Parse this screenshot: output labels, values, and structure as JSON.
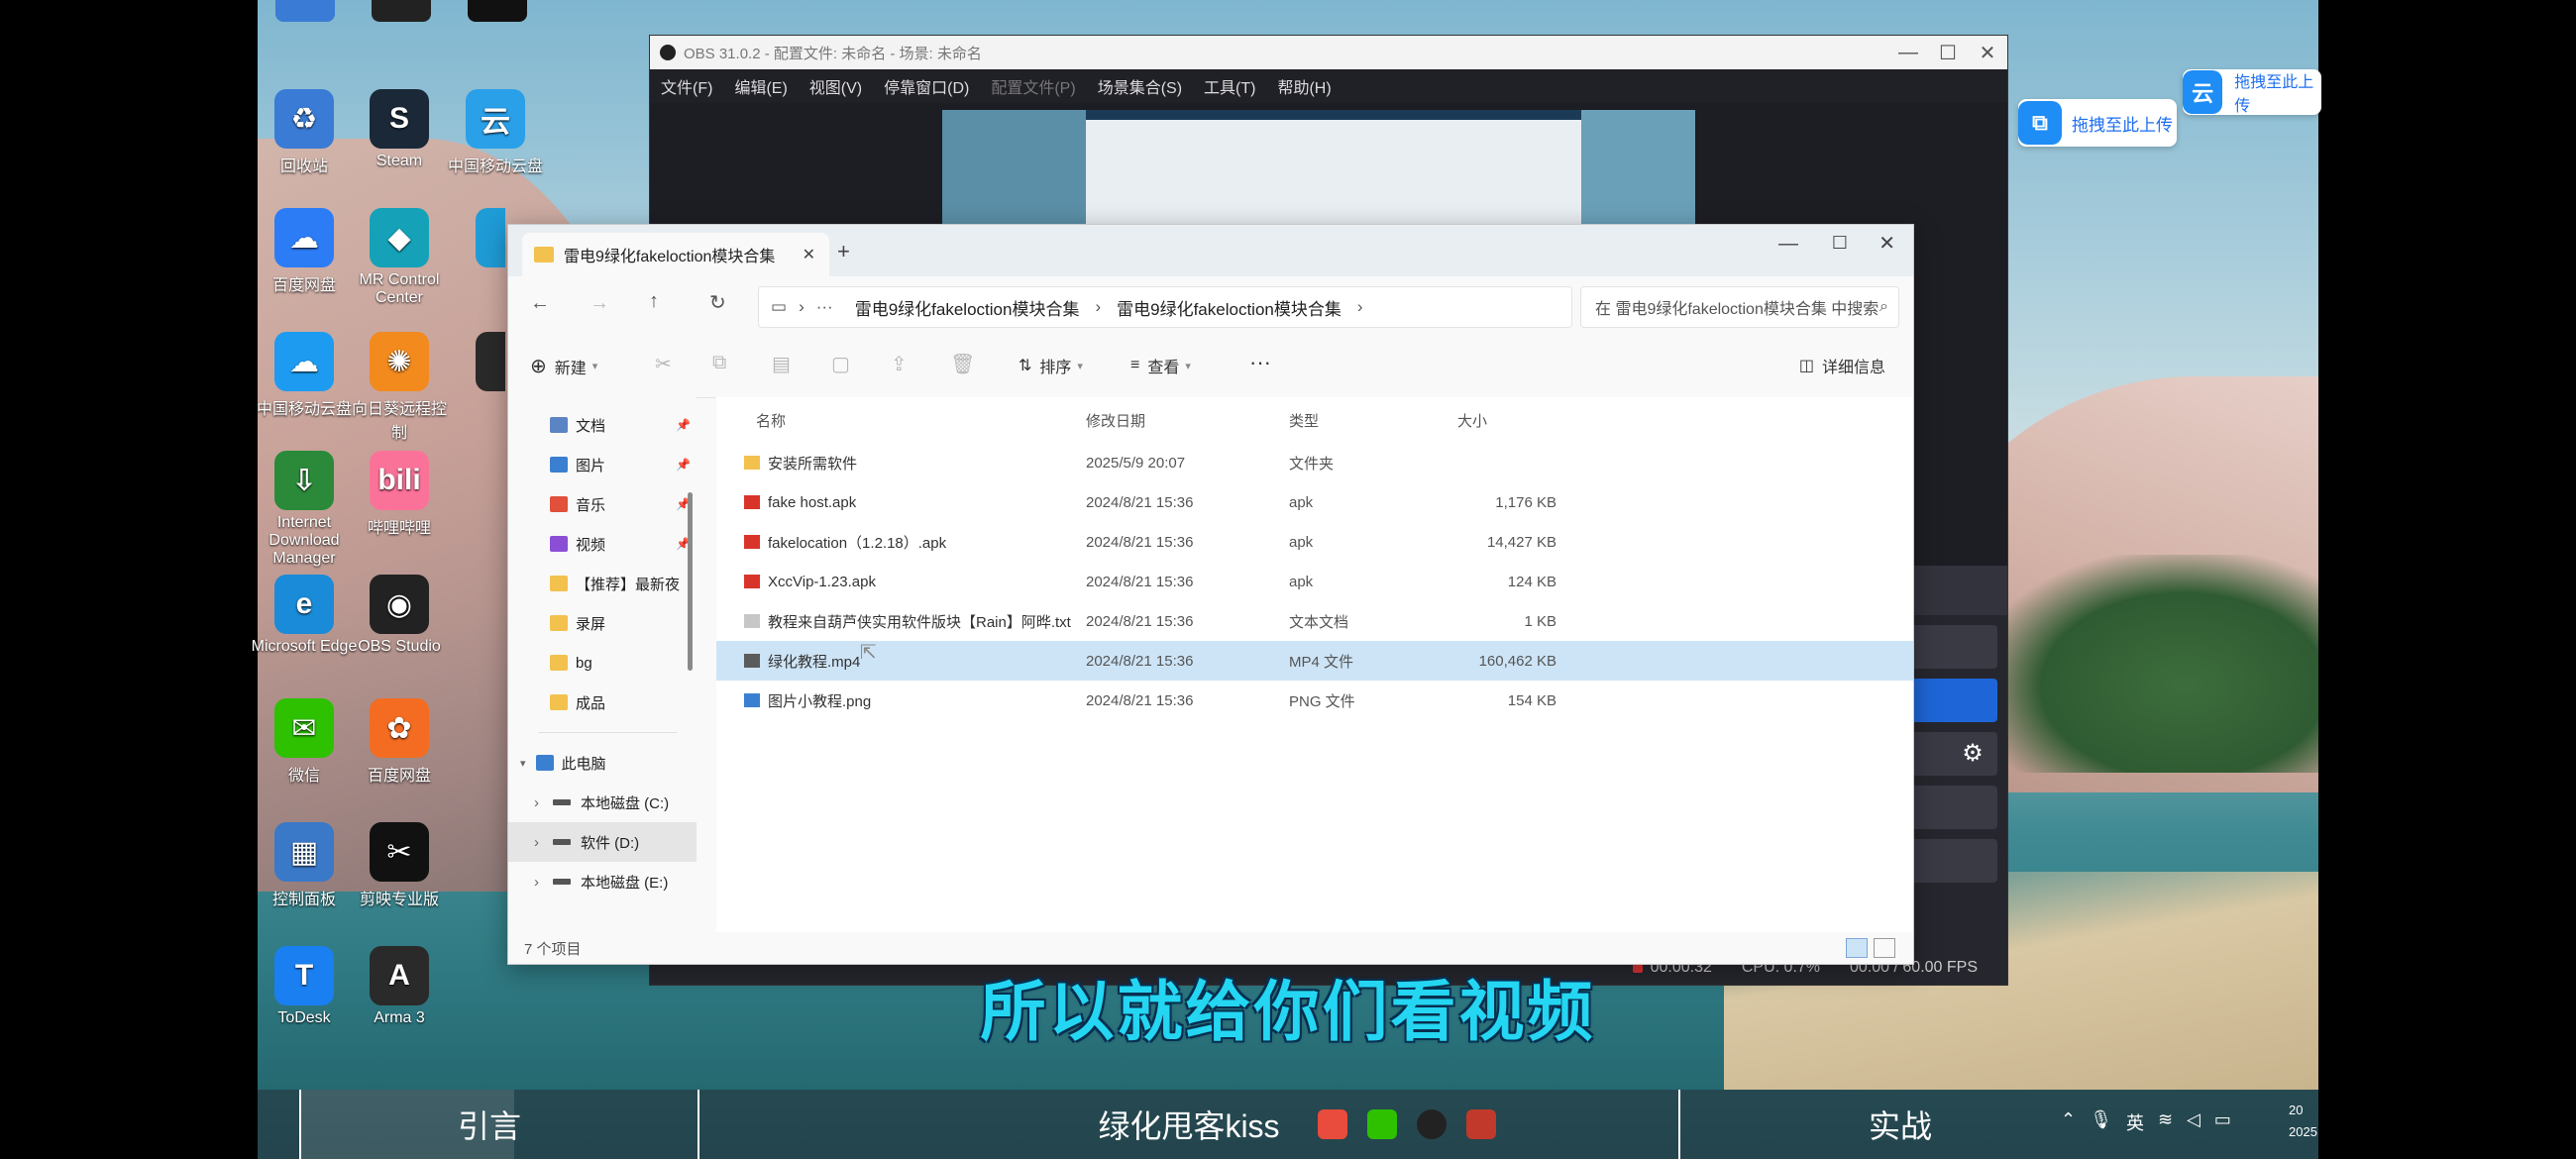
{
  "desktop": {
    "icons": [
      {
        "label": "回收站",
        "color": "#3a7bd5",
        "glyph": "♻"
      },
      {
        "label": "Steam",
        "color": "#1b2838",
        "glyph": "S"
      },
      {
        "label": "中国移动云盘",
        "color": "#2aa0e8",
        "glyph": "云"
      },
      {
        "label": "百度网盘",
        "color": "#2c7cf6",
        "glyph": "☁"
      },
      {
        "label": "MR Control Center",
        "color": "#15a2b8",
        "glyph": "◆"
      },
      {
        "label": "中国移动云盘",
        "color": "#1d9bf0",
        "glyph": "☁"
      },
      {
        "label": "向日葵远程控制",
        "color": "#f28a1d",
        "glyph": "✺"
      },
      {
        "label": "Internet Download Manager",
        "color": "#2a8a3a",
        "glyph": "⇩"
      },
      {
        "label": "哔哩哔哩",
        "color": "#fb7299",
        "glyph": "bili"
      },
      {
        "label": "Microsoft Edge",
        "color": "#1a8bd8",
        "glyph": "e"
      },
      {
        "label": "OBS Studio",
        "color": "#222222",
        "glyph": "◉"
      },
      {
        "label": "微信",
        "color": "#2dc100",
        "glyph": "✉"
      },
      {
        "label": "百度网盘",
        "color": "#f36c21",
        "glyph": "✿"
      },
      {
        "label": "控制面板",
        "color": "#3a78c8",
        "glyph": "▦"
      },
      {
        "label": "剪映专业版",
        "color": "#111111",
        "glyph": "✂"
      },
      {
        "label": "ToDesk",
        "color": "#1a7ff0",
        "glyph": "T"
      },
      {
        "label": "Arma 3",
        "color": "#2a2a2a",
        "glyph": "A"
      }
    ]
  },
  "obs": {
    "title": "OBS 31.0.2 - 配置文件: 未命名 - 场景: 未命名",
    "menu": [
      "文件(F)",
      "编辑(E)",
      "视图(V)",
      "停靠窗口(D)",
      "配置文件(P)",
      "场景集合(S)",
      "工具(T)",
      "帮助(H)"
    ],
    "status_fps": "00.00 / 60.00 FPS",
    "status_cpu": "CPU: 0.7%",
    "status_time": "00:00:32"
  },
  "upload_widgets": {
    "top": "拖拽至此上传",
    "bottom": "拖拽至此上传"
  },
  "explorer": {
    "tab_title": "雷电9绿化fakeloction模块合集",
    "breadcrumb": [
      "雷电9绿化fakeloction模块合集",
      "雷电9绿化fakeloction模块合集"
    ],
    "search_placeholder": "在 雷电9绿化fakeloction模块合集 中搜索",
    "toolbar": {
      "new": "新建",
      "sort": "排序",
      "view": "查看",
      "more": "···",
      "details": "详细信息"
    },
    "nav": [
      {
        "label": "文档",
        "pinned": true,
        "color": "#5b84c4"
      },
      {
        "label": "图片",
        "pinned": true,
        "color": "#3b7fd1"
      },
      {
        "label": "音乐",
        "pinned": true,
        "color": "#e0503a"
      },
      {
        "label": "视频",
        "pinned": true,
        "color": "#8b4fd6"
      },
      {
        "label": "【推荐】最新夜",
        "pinned": false,
        "color": "#f2c14e"
      },
      {
        "label": "录屏",
        "pinned": false,
        "color": "#f2c14e"
      },
      {
        "label": "bg",
        "pinned": false,
        "color": "#f2c14e"
      },
      {
        "label": "成品",
        "pinned": false,
        "color": "#f2c14e"
      }
    ],
    "this_pc": "此电脑",
    "drives": [
      "本地磁盘 (C:)",
      "软件 (D:)",
      "本地磁盘 (E:)"
    ],
    "columns": {
      "name": "名称",
      "date": "修改日期",
      "type": "类型",
      "size": "大小"
    },
    "files": [
      {
        "name": "安装所需软件",
        "date": "2025/5/9 20:07",
        "type": "文件夹",
        "size": "",
        "icon": "folder"
      },
      {
        "name": "fake host.apk",
        "date": "2024/8/21 15:36",
        "type": "apk",
        "size": "1,176 KB",
        "icon": "apk"
      },
      {
        "name": "fakelocation（1.2.18）.apk",
        "date": "2024/8/21 15:36",
        "type": "apk",
        "size": "14,427 KB",
        "icon": "apk"
      },
      {
        "name": "XccVip-1.23.apk",
        "date": "2024/8/21 15:36",
        "type": "apk",
        "size": "124 KB",
        "icon": "apk"
      },
      {
        "name": "教程来自葫芦侠实用软件版块【Rain】阿晔.txt",
        "date": "2024/8/21 15:36",
        "type": "文本文档",
        "size": "1 KB",
        "icon": "txt"
      },
      {
        "name": "绿化教程.mp4",
        "date": "2024/8/21 15:36",
        "type": "MP4 文件",
        "size": "160,462 KB",
        "icon": "mp4"
      },
      {
        "name": "图片小教程.png",
        "date": "2024/8/21 15:36",
        "type": "PNG 文件",
        "size": "154 KB",
        "icon": "png"
      }
    ],
    "status": "7 个项目"
  },
  "subtitle": "所以就给你们看视频",
  "chapters": {
    "left": "引言",
    "center": "绿化甩客kiss",
    "right": "实战"
  },
  "tray": {
    "ime": "英",
    "time": "20",
    "date": "2025"
  }
}
